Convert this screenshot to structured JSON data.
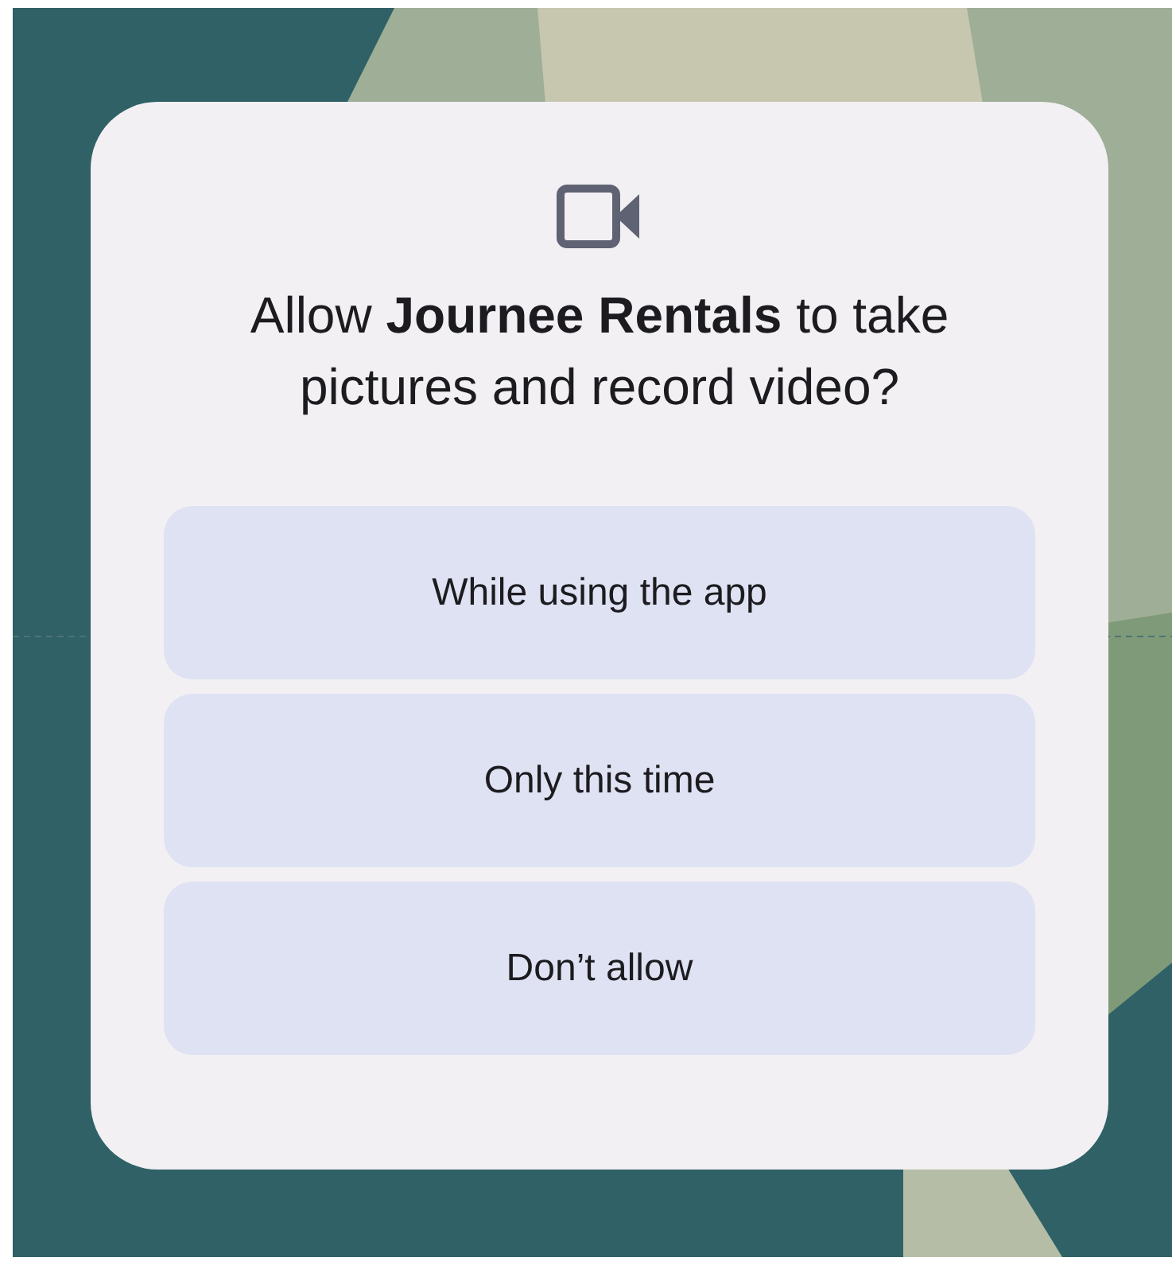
{
  "dialog": {
    "title": "Allow **Journee Rentals** to take pictures and record video?",
    "buttons": [
      {
        "label": "While using the app"
      },
      {
        "label": "Only this time"
      },
      {
        "label": "Don’t allow"
      }
    ]
  }
}
